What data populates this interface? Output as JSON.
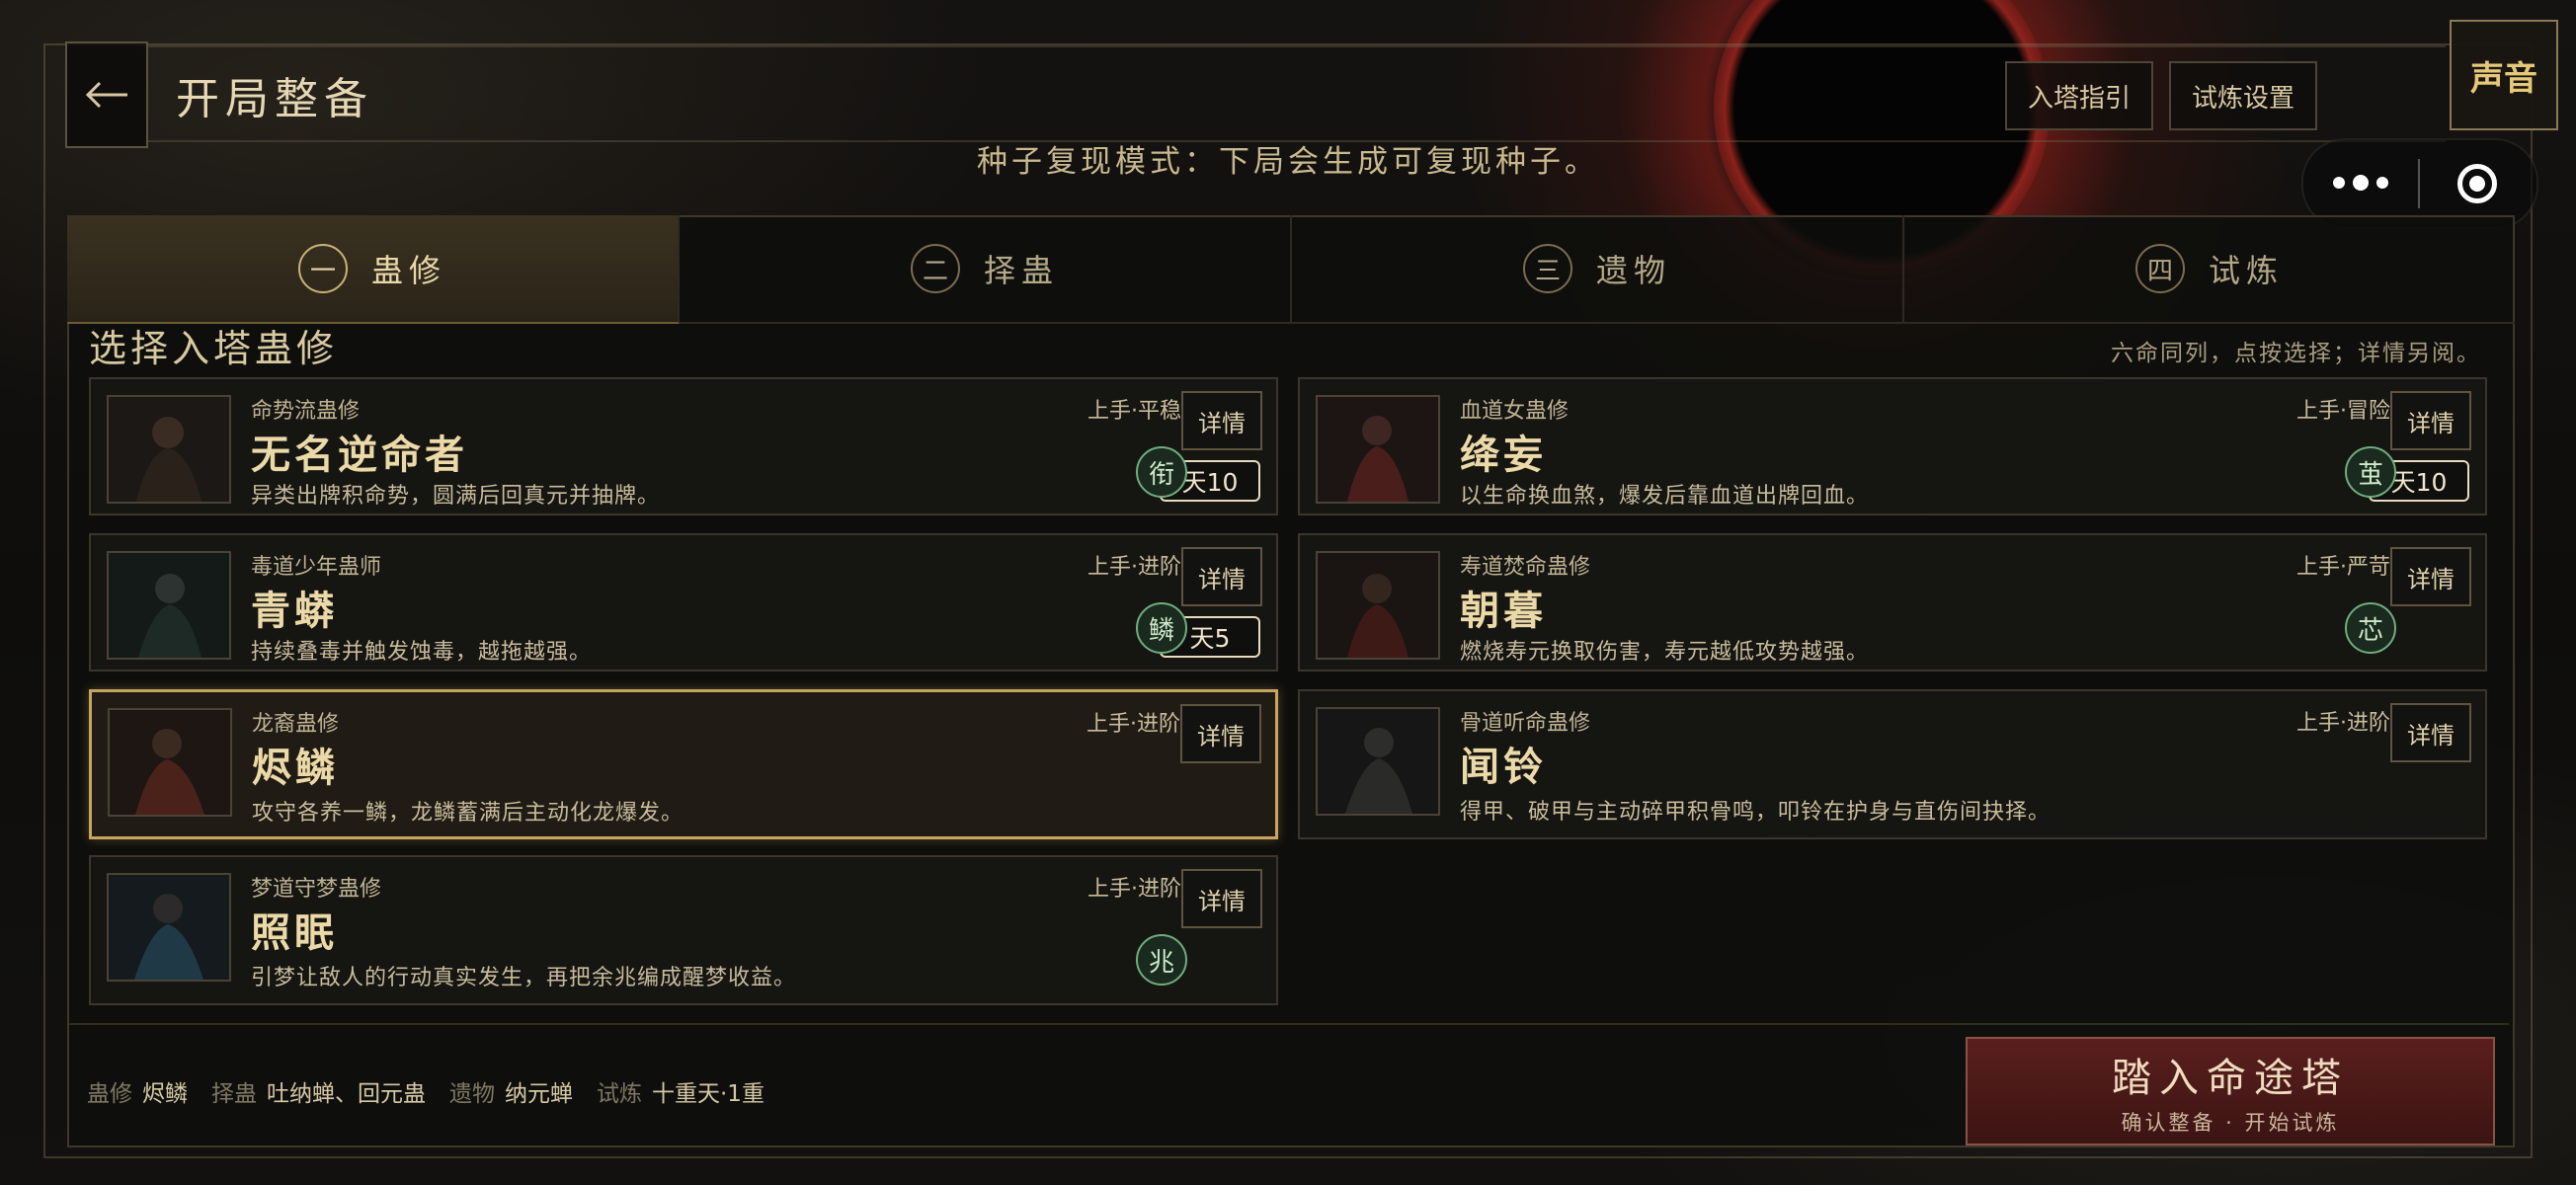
{
  "header": {
    "title": "开局整备",
    "guide_button": "入塔指引",
    "settings_button": "试炼设置",
    "sound_button": "声音",
    "seed_notice": "种子复现模式：下局会生成可复现种子。"
  },
  "tabs": [
    {
      "num": "一",
      "label": "蛊修",
      "active": true
    },
    {
      "num": "二",
      "label": "择蛊",
      "active": false
    },
    {
      "num": "三",
      "label": "遗物",
      "active": false
    },
    {
      "num": "四",
      "label": "试炼",
      "active": false
    }
  ],
  "section": {
    "title": "选择入塔蛊修",
    "hint": "六命同列，点按选择；详情另阅。"
  },
  "detail_label": "详情",
  "characters": [
    {
      "subtitle": "命势流蛊修",
      "name": "无名逆命者",
      "desc": "异类出牌积命势，圆满后回真元并抽牌。",
      "difficulty": "上手·平稳",
      "rune": "衔",
      "badge": "天10"
    },
    {
      "subtitle": "血道女蛊修",
      "name": "绛妄",
      "desc": "以生命换血煞，爆发后靠血道出牌回血。",
      "difficulty": "上手·冒险",
      "rune": "茧",
      "badge": "天10"
    },
    {
      "subtitle": "毒道少年蛊师",
      "name": "青蟒",
      "desc": "持续叠毒并触发蚀毒，越拖越强。",
      "difficulty": "上手·进阶",
      "rune": "鳞",
      "badge": "天5"
    },
    {
      "subtitle": "寿道焚命蛊修",
      "name": "朝暮",
      "desc": "燃烧寿元换取伤害，寿元越低攻势越强。",
      "difficulty": "上手·严苛",
      "rune": "芯",
      "badge": ""
    },
    {
      "subtitle": "龙裔蛊修",
      "name": "烬鳞",
      "desc": "攻守各养一鳞，龙鳞蓄满后主动化龙爆发。",
      "difficulty": "上手·进阶",
      "rune": "",
      "badge": "",
      "selected": true
    },
    {
      "subtitle": "骨道听命蛊修",
      "name": "闻铃",
      "desc": "得甲、破甲与主动碎甲积骨鸣，叩铃在护身与直伤间抉择。",
      "difficulty": "上手·进阶",
      "rune": "",
      "badge": ""
    },
    {
      "subtitle": "梦道守梦蛊修",
      "name": "照眠",
      "desc": "引梦让敌人的行动真实发生，再把余兆编成醒梦收益。",
      "difficulty": "上手·进阶",
      "rune": "兆",
      "badge": ""
    }
  ],
  "summary": {
    "gu_label": "蛊修",
    "gu_value": "烬鳞",
    "pick_label": "择蛊",
    "pick_value": "吐纳蝉、回元蛊",
    "relic_label": "遗物",
    "relic_value": "纳元蝉",
    "trial_label": "试炼",
    "trial_value": "十重天·1重"
  },
  "enter_button": {
    "title": "踏入命途塔",
    "subtitle": "确认整备 · 开始试炼"
  },
  "colors": {
    "accent_gold": "#c8a55f",
    "rune_green": "#6fae7f",
    "enter_red": "#5a1f1d"
  }
}
